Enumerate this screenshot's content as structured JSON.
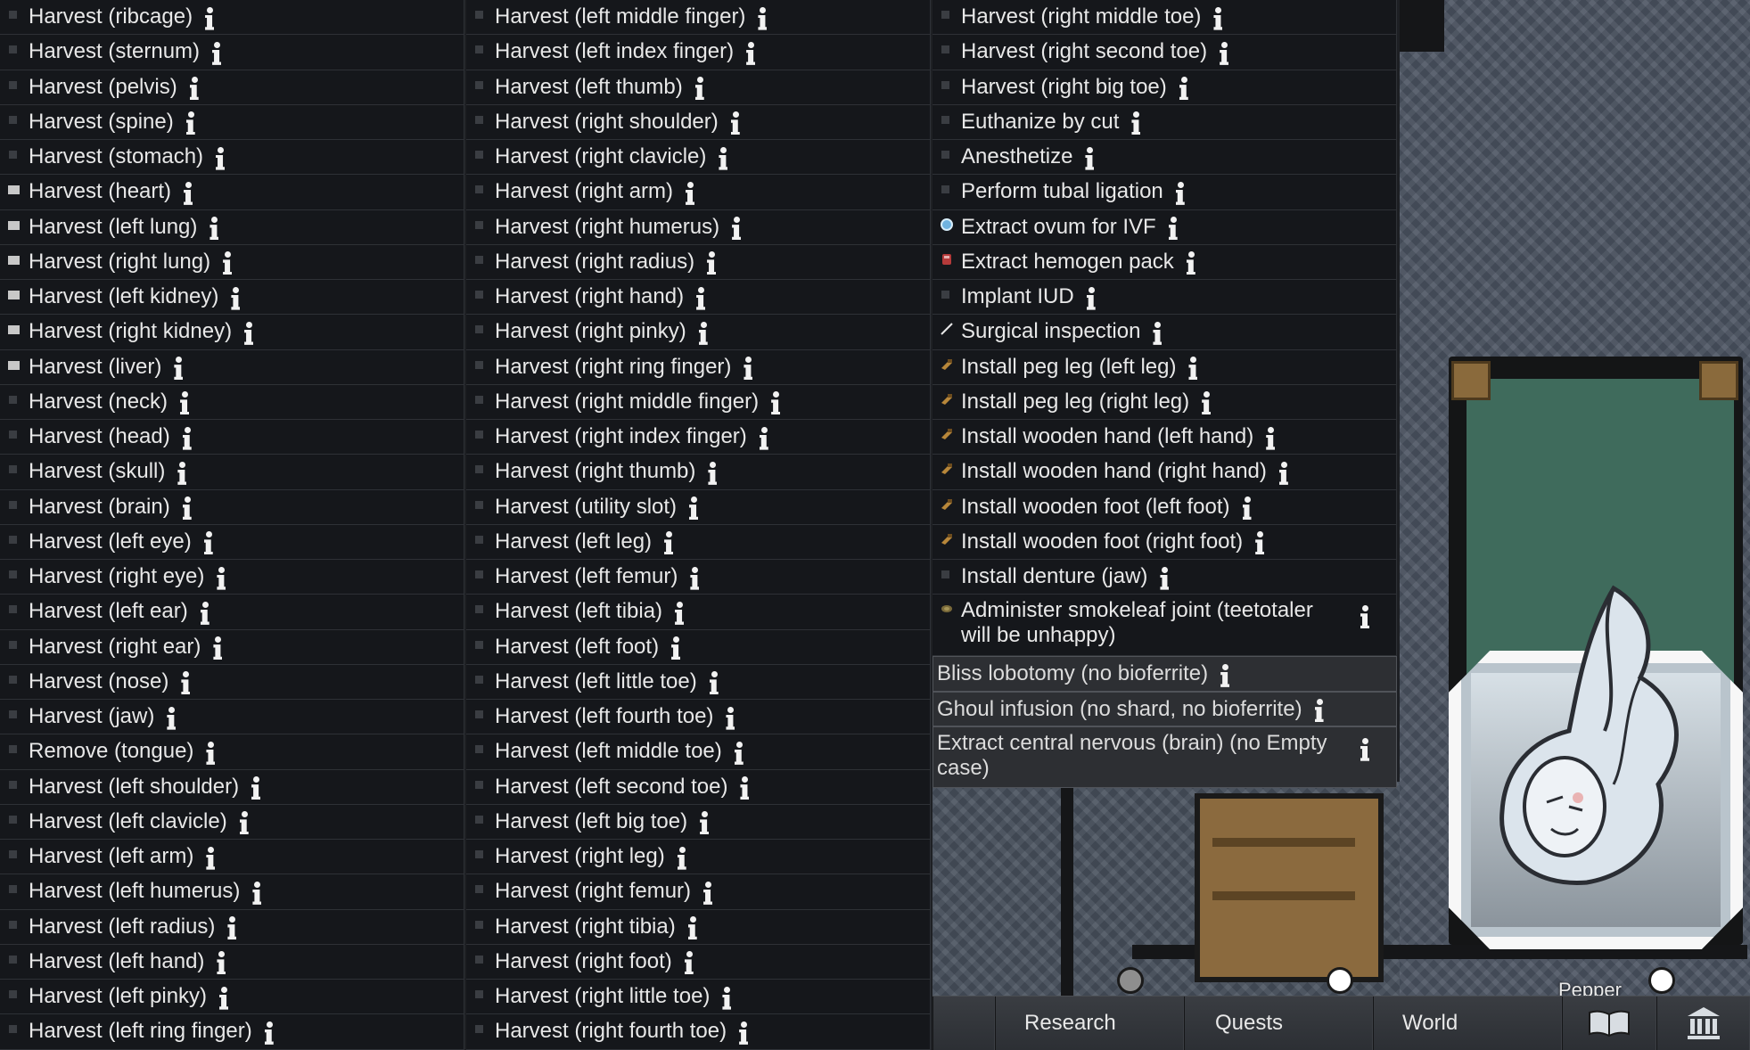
{
  "menu": {
    "columns": [
      [
        {
          "label": "Harvest (ribcage)",
          "icon": "bullet"
        },
        {
          "label": "Harvest (sternum)",
          "icon": "bullet"
        },
        {
          "label": "Harvest (pelvis)",
          "icon": "bullet"
        },
        {
          "label": "Harvest (spine)",
          "icon": "bullet"
        },
        {
          "label": "Harvest (stomach)",
          "icon": "bullet"
        },
        {
          "label": "Harvest (heart)",
          "icon": "organ-icon"
        },
        {
          "label": "Harvest (left lung)",
          "icon": "organ-icon"
        },
        {
          "label": "Harvest (right lung)",
          "icon": "organ-icon"
        },
        {
          "label": "Harvest (left kidney)",
          "icon": "organ-icon"
        },
        {
          "label": "Harvest (right kidney)",
          "icon": "organ-icon"
        },
        {
          "label": "Harvest (liver)",
          "icon": "organ-icon"
        },
        {
          "label": "Harvest (neck)",
          "icon": "bullet"
        },
        {
          "label": "Harvest (head)",
          "icon": "bullet"
        },
        {
          "label": "Harvest (skull)",
          "icon": "bullet"
        },
        {
          "label": "Harvest (brain)",
          "icon": "bullet"
        },
        {
          "label": "Harvest (left eye)",
          "icon": "bullet"
        },
        {
          "label": "Harvest (right eye)",
          "icon": "bullet"
        },
        {
          "label": "Harvest (left ear)",
          "icon": "bullet"
        },
        {
          "label": "Harvest (right ear)",
          "icon": "bullet"
        },
        {
          "label": "Harvest (nose)",
          "icon": "bullet"
        },
        {
          "label": "Harvest (jaw)",
          "icon": "bullet"
        },
        {
          "label": "Remove (tongue)",
          "icon": "bullet"
        },
        {
          "label": "Harvest (left shoulder)",
          "icon": "bullet"
        },
        {
          "label": "Harvest (left clavicle)",
          "icon": "bullet"
        },
        {
          "label": "Harvest (left arm)",
          "icon": "bullet"
        },
        {
          "label": "Harvest (left humerus)",
          "icon": "bullet"
        },
        {
          "label": "Harvest (left radius)",
          "icon": "bullet"
        },
        {
          "label": "Harvest (left hand)",
          "icon": "bullet"
        },
        {
          "label": "Harvest (left pinky)",
          "icon": "bullet"
        },
        {
          "label": "Harvest (left ring finger)",
          "icon": "bullet"
        }
      ],
      [
        {
          "label": "Harvest (left middle finger)",
          "icon": "bullet"
        },
        {
          "label": "Harvest (left index finger)",
          "icon": "bullet"
        },
        {
          "label": "Harvest (left thumb)",
          "icon": "bullet"
        },
        {
          "label": "Harvest (right shoulder)",
          "icon": "bullet"
        },
        {
          "label": "Harvest (right clavicle)",
          "icon": "bullet"
        },
        {
          "label": "Harvest (right arm)",
          "icon": "bullet"
        },
        {
          "label": "Harvest (right humerus)",
          "icon": "bullet"
        },
        {
          "label": "Harvest (right radius)",
          "icon": "bullet"
        },
        {
          "label": "Harvest (right hand)",
          "icon": "bullet"
        },
        {
          "label": "Harvest (right pinky)",
          "icon": "bullet"
        },
        {
          "label": "Harvest (right ring finger)",
          "icon": "bullet"
        },
        {
          "label": "Harvest (right middle finger)",
          "icon": "bullet"
        },
        {
          "label": "Harvest (right index finger)",
          "icon": "bullet"
        },
        {
          "label": "Harvest (right thumb)",
          "icon": "bullet"
        },
        {
          "label": "Harvest (utility slot)",
          "icon": "bullet"
        },
        {
          "label": "Harvest (left leg)",
          "icon": "bullet"
        },
        {
          "label": "Harvest (left femur)",
          "icon": "bullet"
        },
        {
          "label": "Harvest (left tibia)",
          "icon": "bullet"
        },
        {
          "label": "Harvest (left foot)",
          "icon": "bullet"
        },
        {
          "label": "Harvest (left little toe)",
          "icon": "bullet"
        },
        {
          "label": "Harvest (left fourth toe)",
          "icon": "bullet"
        },
        {
          "label": "Harvest (left middle toe)",
          "icon": "bullet"
        },
        {
          "label": "Harvest (left second toe)",
          "icon": "bullet"
        },
        {
          "label": "Harvest (left big toe)",
          "icon": "bullet"
        },
        {
          "label": "Harvest (right leg)",
          "icon": "bullet"
        },
        {
          "label": "Harvest (right femur)",
          "icon": "bullet"
        },
        {
          "label": "Harvest (right tibia)",
          "icon": "bullet"
        },
        {
          "label": "Harvest (right foot)",
          "icon": "bullet"
        },
        {
          "label": "Harvest (right little toe)",
          "icon": "bullet"
        },
        {
          "label": "Harvest (right fourth toe)",
          "icon": "bullet"
        }
      ],
      [
        {
          "label": "Harvest (right middle toe)",
          "icon": "bullet"
        },
        {
          "label": "Harvest (right second toe)",
          "icon": "bullet"
        },
        {
          "label": "Harvest (right big toe)",
          "icon": "bullet"
        },
        {
          "label": "Euthanize by cut",
          "icon": "bullet"
        },
        {
          "label": "Anesthetize",
          "icon": "bullet"
        },
        {
          "label": "Perform tubal ligation",
          "icon": "bullet"
        },
        {
          "label": "Extract ovum for IVF",
          "icon": "ovum-icon"
        },
        {
          "label": "Extract hemogen pack",
          "icon": "hemogen-pack-icon"
        },
        {
          "label": "Implant IUD",
          "icon": "bullet"
        },
        {
          "label": "Surgical inspection",
          "icon": "scalpel-icon"
        },
        {
          "label": "Install peg leg (left leg)",
          "icon": "wood-prosthetic-icon"
        },
        {
          "label": "Install peg leg (right leg)",
          "icon": "wood-prosthetic-icon"
        },
        {
          "label": "Install wooden hand (left hand)",
          "icon": "wood-prosthetic-icon"
        },
        {
          "label": "Install wooden hand (right hand)",
          "icon": "wood-prosthetic-icon"
        },
        {
          "label": "Install wooden foot (left foot)",
          "icon": "wood-prosthetic-icon"
        },
        {
          "label": "Install wooden foot (right foot)",
          "icon": "wood-prosthetic-icon"
        },
        {
          "label": "Install denture (jaw)",
          "icon": "bullet"
        },
        {
          "label": "Administer smokeleaf joint (teetotaler will be unhappy)",
          "icon": "smokeleaf-icon",
          "tall": true
        },
        {
          "label": "Bliss lobotomy (no bioferrite)",
          "icon": "none",
          "disabled": true
        },
        {
          "label": "Ghoul infusion (no shard, no bioferrite)",
          "icon": "none",
          "disabled": true
        },
        {
          "label": "Extract central nervous (brain) (no Empty case)",
          "icon": "none",
          "disabled": true,
          "tall": true
        }
      ]
    ]
  },
  "world": {
    "pawn_name": "Pepper"
  },
  "bottom_bar": {
    "tabs": [
      "Research",
      "Quests",
      "World"
    ],
    "icons": [
      "book-icon",
      "museum-icon"
    ]
  },
  "colors": {
    "menu_bg": "#15171b",
    "menu_disabled_bg": "#2d2f33",
    "text": "#e8e8e8",
    "bed_sheet": "#3f6b5c",
    "wood": "#8a6a3c"
  }
}
